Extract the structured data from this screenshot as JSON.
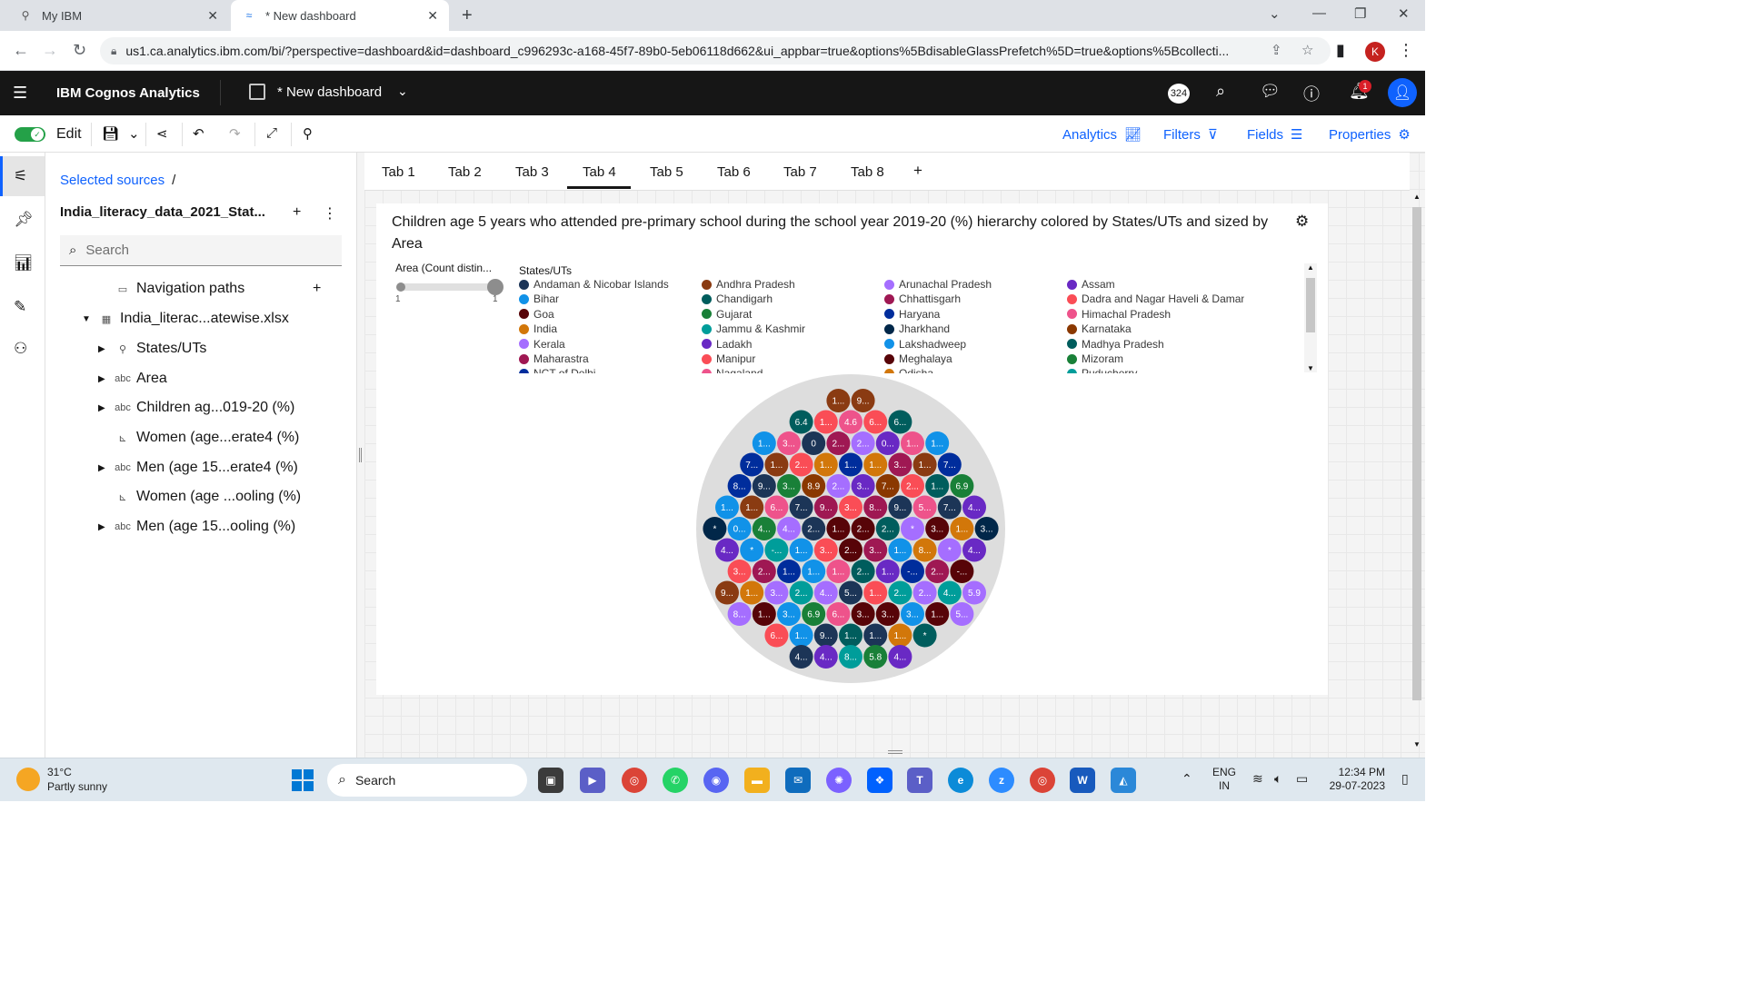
{
  "browser": {
    "tabs": [
      {
        "title": "My IBM",
        "active": false
      },
      {
        "title": "* New dashboard",
        "active": true
      }
    ],
    "url": "us1.ca.analytics.ibm.com/bi/?perspective=dashboard&id=dashboard_c996293c-a168-45f7-89b0-5eb06118d662&ui_appbar=true&options%5BdisableGlassPrefetch%5D=true&options%5Bcollecti...",
    "profile_initial": "K"
  },
  "app": {
    "brand": "IBM Cognos Analytics",
    "dashboard_name": "* New dashboard",
    "badge_count": "324",
    "notification_count": "1"
  },
  "toolbar": {
    "edit_label": "Edit",
    "right": [
      {
        "label": "Analytics",
        "icon": "analytics-icon"
      },
      {
        "label": "Filters",
        "icon": "filter-icon"
      },
      {
        "label": "Fields",
        "icon": "fields-icon"
      },
      {
        "label": "Properties",
        "icon": "properties-icon"
      }
    ]
  },
  "sources": {
    "crumb": "Selected sources",
    "crumb_sep": "/",
    "name": "India_literacy_data_2021_Stat...",
    "search_placeholder": "Search",
    "tree": [
      {
        "label": "Navigation paths",
        "icon": "folder-icon",
        "arrow": ""
      },
      {
        "label": "India_literac...atewise.xlsx",
        "icon": "table-icon",
        "arrow": "▼"
      },
      {
        "label": "States/UTs",
        "icon": "location-icon",
        "arrow": "▶"
      },
      {
        "label": "Area",
        "icon": "abc",
        "arrow": "▶"
      },
      {
        "label": "Children ag...019-20 (%)",
        "icon": "abc",
        "arrow": "▶"
      },
      {
        "label": "Women (age...erate4 (%)",
        "icon": "measure-icon",
        "arrow": ""
      },
      {
        "label": "Men (age 15...erate4 (%)",
        "icon": "abc",
        "arrow": "▶"
      },
      {
        "label": "Women (age ...ooling (%)",
        "icon": "measure-icon",
        "arrow": ""
      },
      {
        "label": "Men (age 15...ooling (%)",
        "icon": "abc",
        "arrow": "▶"
      }
    ]
  },
  "dashboard_tabs": [
    "Tab 1",
    "Tab 2",
    "Tab 3",
    "Tab 4",
    "Tab 5",
    "Tab 6",
    "Tab 7",
    "Tab 8"
  ],
  "active_tab": "Tab 4",
  "widget": {
    "title": "Children age 5 years who attended pre-primary school during the school year 2019-20 (%) hierarchy colored by States/UTs and sized by Area",
    "size_legend_title": "Area (Count distin...",
    "size_min": "1",
    "size_max": "1",
    "color_legend_title": "States/UTs",
    "legend": [
      {
        "label": "Andaman & Nicobar Islands",
        "color": "#1c3557"
      },
      {
        "label": "Andhra Pradesh",
        "color": "#8a3b12"
      },
      {
        "label": "Arunachal Pradesh",
        "color": "#a56eff"
      },
      {
        "label": "Assam",
        "color": "#6929c4"
      },
      {
        "label": "Bihar",
        "color": "#1192e8"
      },
      {
        "label": "Chandigarh",
        "color": "#005d5d"
      },
      {
        "label": "Chhattisgarh",
        "color": "#9f1853"
      },
      {
        "label": "Dadra and Nagar Haveli & Daman ...",
        "color": "#fa4d56"
      },
      {
        "label": "Goa",
        "color": "#570408"
      },
      {
        "label": "Gujarat",
        "color": "#198038"
      },
      {
        "label": "Haryana",
        "color": "#002d9c"
      },
      {
        "label": "Himachal Pradesh",
        "color": "#ee538b"
      },
      {
        "label": "India",
        "color": "#d2770a"
      },
      {
        "label": "Jammu & Kashmir",
        "color": "#009d9a"
      },
      {
        "label": "Jharkhand",
        "color": "#012749"
      },
      {
        "label": "Karnataka",
        "color": "#8a3800"
      },
      {
        "label": "Kerala",
        "color": "#a56eff"
      },
      {
        "label": "Ladakh",
        "color": "#6929c4"
      },
      {
        "label": "Lakshadweep",
        "color": "#1192e8"
      },
      {
        "label": "Madhya Pradesh",
        "color": "#005d5d"
      },
      {
        "label": "Maharastra",
        "color": "#9f1853"
      },
      {
        "label": "Manipur",
        "color": "#fa4d56"
      },
      {
        "label": "Meghalaya",
        "color": "#570408"
      },
      {
        "label": "Mizoram",
        "color": "#198038"
      },
      {
        "label": "NCT of Delhi",
        "color": "#002d9c"
      },
      {
        "label": "Nagaland",
        "color": "#ee538b"
      },
      {
        "label": "Odisha",
        "color": "#d2770a"
      },
      {
        "label": "Puducherry",
        "color": "#009d9a"
      }
    ]
  },
  "chart_data": {
    "type": "packed-bubble",
    "outer_color": "#dddddd",
    "rows": [
      {
        "labels": [
          "1...",
          "9..."
        ],
        "colors": [
          "#8a3b12",
          "#8a3b12"
        ]
      },
      {
        "labels": [
          "6.4",
          "1...",
          "4.6",
          "6...",
          "6..."
        ],
        "colors": [
          "#005d5d",
          "#fa4d56",
          "#ee538b",
          "#fa4d56",
          "#005d5d"
        ]
      },
      {
        "labels": [
          "1...",
          "3...",
          "0",
          "2...",
          "2...",
          "0...",
          "1...",
          "1..."
        ],
        "colors": [
          "#1192e8",
          "#ee538b",
          "#1c3557",
          "#9f1853",
          "#a56eff",
          "#6929c4",
          "#ee538b",
          "#1192e8"
        ]
      },
      {
        "labels": [
          "7...",
          "1...",
          "2...",
          "1...",
          "1...",
          "1...",
          "3...",
          "1...",
          "7..."
        ],
        "colors": [
          "#002d9c",
          "#8a3b12",
          "#fa4d56",
          "#d2770a",
          "#002d9c",
          "#d2770a",
          "#9f1853",
          "#8a3b12",
          "#002d9c"
        ]
      },
      {
        "labels": [
          "8...",
          "9...",
          "3...",
          "8.9",
          "2...",
          "3...",
          "7...",
          "2...",
          "1...",
          "6.9"
        ],
        "colors": [
          "#002d9c",
          "#1c3557",
          "#198038",
          "#8a3800",
          "#a56eff",
          "#6929c4",
          "#8a3800",
          "#fa4d56",
          "#005d5d",
          "#198038"
        ]
      },
      {
        "labels": [
          "1...",
          "1...",
          "6...",
          "7...",
          "9...",
          "3...",
          "8...",
          "9...",
          "5...",
          "7...",
          "4..."
        ],
        "colors": [
          "#1192e8",
          "#8a3b12",
          "#ee538b",
          "#1c3557",
          "#9f1853",
          "#fa4d56",
          "#9f1853",
          "#1c3557",
          "#ee538b",
          "#1c3557",
          "#6929c4"
        ]
      },
      {
        "labels": [
          "*",
          "0...",
          "4...",
          "4...",
          "2...",
          "1...",
          "2...",
          "2...",
          "*",
          "3...",
          "1...",
          "3..."
        ],
        "colors": [
          "#012749",
          "#1192e8",
          "#198038",
          "#a56eff",
          "#1c3557",
          "#570408",
          "#570408",
          "#005d5d",
          "#a56eff",
          "#570408",
          "#d2770a",
          "#012749"
        ]
      },
      {
        "labels": [
          "4...",
          "*",
          "-...",
          "1...",
          "3...",
          "2...",
          "3...",
          "1...",
          "8...",
          "*",
          "4..."
        ],
        "colors": [
          "#6929c4",
          "#1192e8",
          "#009d9a",
          "#1192e8",
          "#fa4d56",
          "#570408",
          "#9f1853",
          "#1192e8",
          "#d2770a",
          "#a56eff",
          "#6929c4"
        ]
      },
      {
        "labels": [
          "3...",
          "2...",
          "1...",
          "1...",
          "1...",
          "2...",
          "1...",
          "-...",
          "2...",
          "-..."
        ],
        "colors": [
          "#fa4d56",
          "#9f1853",
          "#002d9c",
          "#1192e8",
          "#ee538b",
          "#005d5d",
          "#6929c4",
          "#002d9c",
          "#9f1853",
          "#570408"
        ]
      },
      {
        "labels": [
          "9...",
          "1...",
          "3...",
          "2...",
          "4...",
          "5...",
          "1...",
          "2...",
          "2...",
          "4...",
          "5.9"
        ],
        "colors": [
          "#8a3b12",
          "#d2770a",
          "#a56eff",
          "#009d9a",
          "#a56eff",
          "#1c3557",
          "#fa4d56",
          "#009d9a",
          "#a56eff",
          "#009d9a",
          "#a56eff"
        ]
      },
      {
        "labels": [
          "8...",
          "1...",
          "3...",
          "6.9",
          "6...",
          "3...",
          "3...",
          "3...",
          "1...",
          "5..."
        ],
        "colors": [
          "#a56eff",
          "#570408",
          "#1192e8",
          "#198038",
          "#ee538b",
          "#570408",
          "#570408",
          "#1192e8",
          "#570408",
          "#a56eff"
        ]
      },
      {
        "labels": [
          "6...",
          "1...",
          "9...",
          "1...",
          "1...",
          "1...",
          "*"
        ],
        "colors": [
          "#fa4d56",
          "#1192e8",
          "#1c3557",
          "#005d5d",
          "#1c3557",
          "#d2770a",
          "#005d5d"
        ]
      },
      {
        "labels": [
          "4...",
          "4...",
          "8...",
          "5.8",
          "4..."
        ],
        "colors": [
          "#1c3557",
          "#6929c4",
          "#009d9a",
          "#198038",
          "#6929c4"
        ]
      }
    ]
  },
  "taskbar": {
    "temp": "31°C",
    "weather": "Partly sunny",
    "search": "Search",
    "lang1": "ENG",
    "lang2": "IN",
    "time": "12:34 PM",
    "date": "29-07-2023"
  }
}
